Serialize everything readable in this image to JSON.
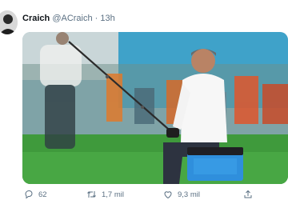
{
  "tweet": {
    "author_name": "Craich",
    "handle": "@ACraich",
    "separator": "·",
    "time": "13h",
    "media": {
      "description_icon": "photo"
    },
    "actions": {
      "reply_count": "62",
      "retweet_count": "1,7 mil",
      "like_count": "9,3 mil"
    }
  },
  "colors": {
    "text": "#0f1419",
    "secondary": "#5b7083",
    "pitch": "#3f9a3c",
    "cooler": "#2f8fdc"
  },
  "icons": [
    "avatar",
    "reply-icon",
    "retweet-icon",
    "like-icon",
    "share-icon"
  ]
}
